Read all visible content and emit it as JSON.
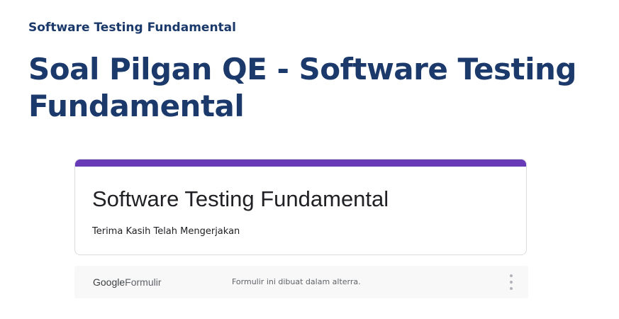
{
  "header": {
    "eyebrow": "Software Testing Fundamental",
    "title": "Soal Pilgan QE - Software Testing Fundamental"
  },
  "form": {
    "title": "Software Testing Fundamental",
    "message": "Terima Kasih Telah Mengerjakan",
    "accent_color": "#673ab7"
  },
  "footer": {
    "brand_google": "Google",
    "brand_product": "Formulir",
    "note": "Formulir ini dibuat dalam alterra.",
    "menu_icon": "more-vertical-icon"
  },
  "colors": {
    "heading": "#1b3a6b",
    "card_border": "#dadce0",
    "footer_bg": "#f8f8f8"
  }
}
